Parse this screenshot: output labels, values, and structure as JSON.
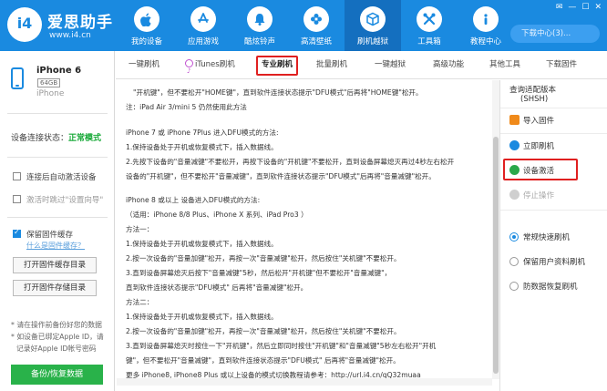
{
  "app": {
    "logo_mark": "i4",
    "logo_name": "爱思助手",
    "logo_url": "www.i4.cn",
    "window_controls": [
      "✉",
      "—",
      "☐",
      "✕"
    ],
    "download_label": "下载中心(3)..."
  },
  "nav": [
    {
      "label": "我的设备",
      "icon": "apple-icon"
    },
    {
      "label": "应用游戏",
      "icon": "app-store-icon"
    },
    {
      "label": "酷炫铃声",
      "icon": "bell-icon"
    },
    {
      "label": "高清壁纸",
      "icon": "flower-icon"
    },
    {
      "label": "刷机越狱",
      "icon": "box-icon"
    },
    {
      "label": "工具箱",
      "icon": "toolbox-icon"
    },
    {
      "label": "教程中心",
      "icon": "info-icon"
    }
  ],
  "device": {
    "name": "iPhone 6",
    "capacity": "64GB",
    "model": "iPhone",
    "status_label": "设备连接状态：",
    "status_value": "正常模式"
  },
  "left_options": {
    "auto_activate": "连接后自动激活设备",
    "skip_guide": "激活时跳过\"设置向导\"",
    "keep_firmware": "保留固件缓存",
    "what_is_cache": "什么是固件缓存？",
    "open_cache_dir": "打开固件缓存目录",
    "open_store_dir": "打开固件存储目录",
    "notes": [
      "* 请在操作前备份好您的数据",
      "* 如设备已绑定Apple ID，请",
      "记录好Apple ID帐号密码"
    ],
    "backup_button": "备份/恢复数据"
  },
  "subtabs": [
    "一键刷机",
    "iTunes刷机",
    "专业刷机",
    "批量刷机",
    "一键越狱",
    "高级功能",
    "其他工具",
    "下载固件"
  ],
  "content_lines": [
    "\"开机键\"，但不要松开\"HOME键\"，直到软件连接状态提示\"DFU模式\"后再将\"HOME键\"松开。",
    "注：iPad Air 3/mini 5 仍然使用此方法",
    "",
    "iPhone 7 或 iPhone 7Plus 进入DFU模式的方法:",
    "1.保持设备处于开机或恢复模式下，插入数据线。",
    "2.先按下设备的\"音量减键\"不要松开，再按下设备的\"开机键\"不要松开，直到设备屏幕熄灭再过4秒左右松开",
    "  设备的\"开机键\"，但不要松开\"音量减键\"，直到软件连接状态提示\"DFU模式\"后再将\"音量减键\"松开。",
    "",
    "iPhone 8 或以上 设备进入DFU模式的方法:",
    "（适用：iPhone 8/8 Plus、iPhone X 系列、iPad Pro3 ）",
    "方法一：",
    "1.保持设备处于开机或恢复模式下，插入数据线。",
    "2.按一次设备的\"音量加键\"松开，再按一次\"音量减键\"松开，然后按住\"关机键\"不要松开。",
    "3.直到设备屏幕熄灭后按下\"音量减键\"5秒，然后松开\"开机键\"但不要松开\"音量减键\"，",
    "直到软件连接状态提示\"DFU模式\" 后再将\"音量减键\"松开。",
    "方法二：",
    "1.保持设备处于开机或恢复模式下，插入数据线。",
    "2.按一次设备的\"音量加键\"松开，再按一次\"音量减键\"松开，然后按住\"关机键\"不要松开。",
    "3.直到设备屏幕熄灭时按住一下\"开机键\"，然后立即同时按住\"开机键\"和\"音量减键\"5秒左右松开\"开机",
    "  键\"，但不要松开\"音量减键\"，直到软件连接状态提示\"DFU模式\" 后再将\"音量减键\"松开。",
    "更多 iPhone8, iPhone8 Plus 或以上设备的模式切换教程请参考：http://url.i4.cn/qQ32muaa"
  ],
  "right_actions": {
    "query_version": "查询适配版本",
    "query_version_sub": "(SHSH)",
    "import_firmware": "导入固件",
    "flash_now": "立即刷机",
    "activate_device": "设备激活",
    "stop": "停止操作"
  },
  "flash_modes": [
    "常规快速刷机",
    "保留用户资料刷机",
    "防数据恢复刷机"
  ],
  "colors": {
    "brand": "#1a8ae0",
    "highlight": "#e02020",
    "ok": "#1aaa3a",
    "backup": "#29b24a"
  }
}
